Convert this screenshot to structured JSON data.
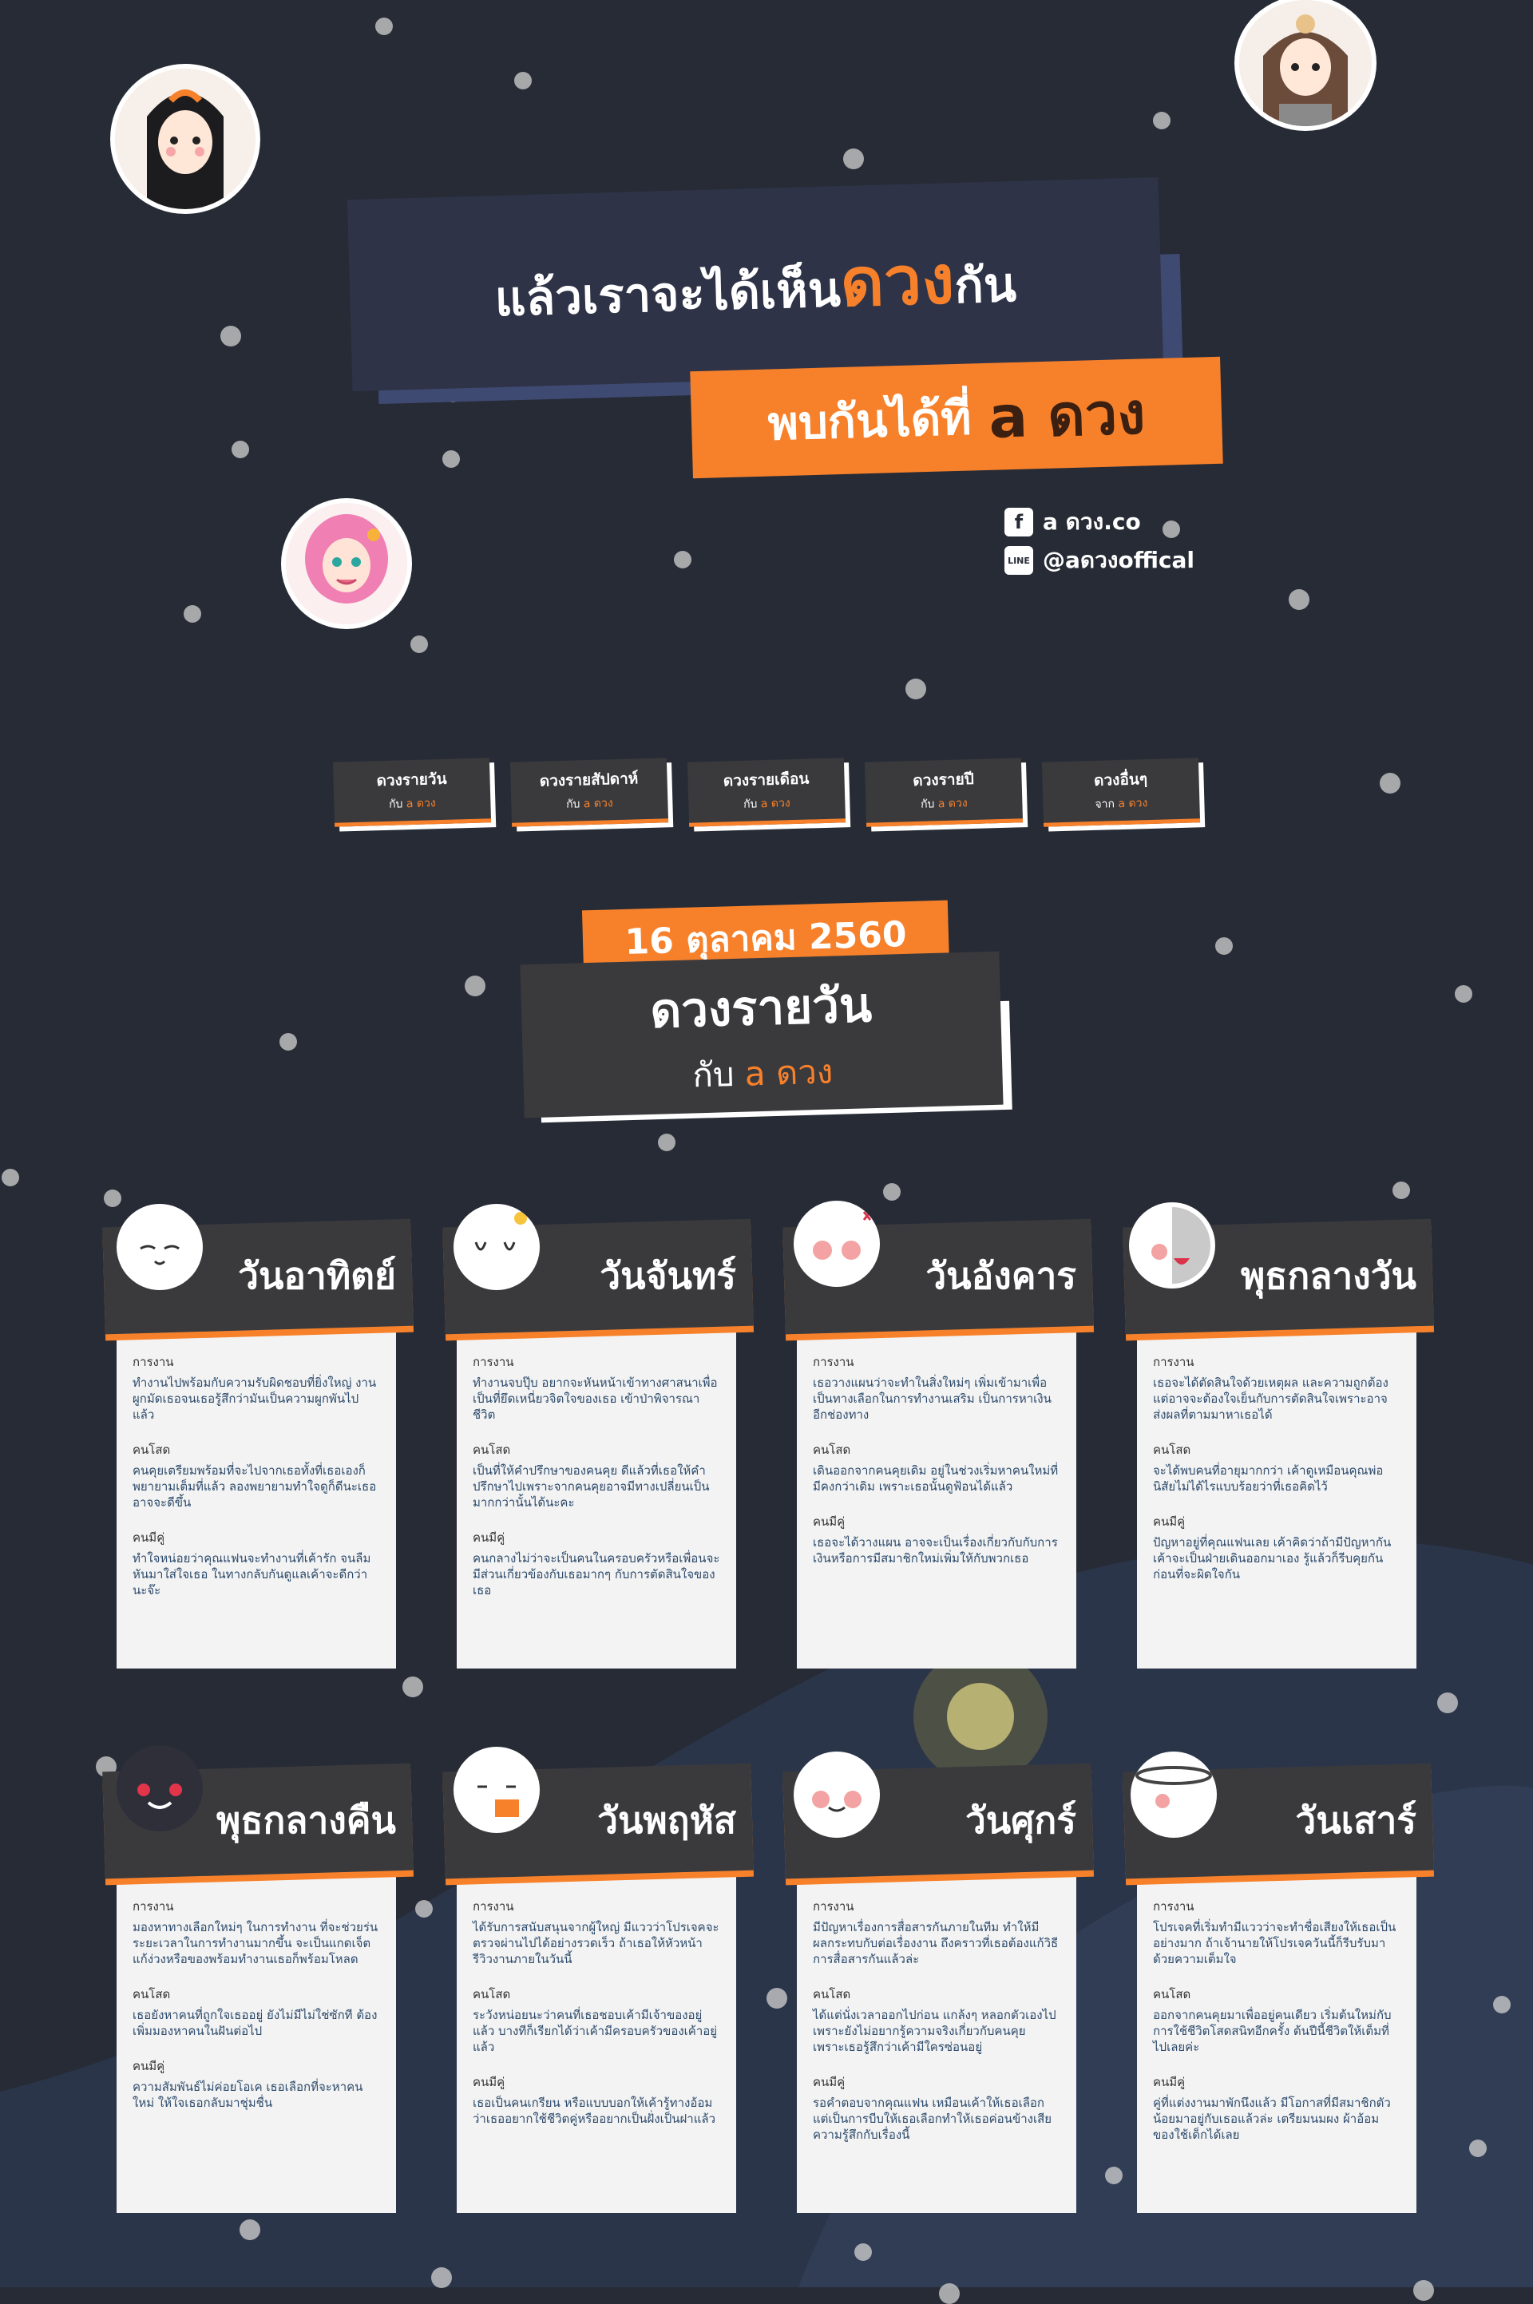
{
  "header": {
    "title_prefix": "แล้วเราจะได้เห็น",
    "title_highlight": "ดวง",
    "title_suffix": "กัน",
    "meet_text": "พบกันได้ที่",
    "meet_brand": "a ดวง"
  },
  "social": {
    "facebook": "a ดวง.co",
    "line": "@aดวงoffical",
    "facebook_icon": "facebook-icon",
    "line_icon": "line-icon"
  },
  "nav": [
    {
      "title": "ดวงรายวัน",
      "sub_prefix": "กับ",
      "sub_brand": "a ดวง"
    },
    {
      "title": "ดวงรายสัปดาห์",
      "sub_prefix": "กับ",
      "sub_brand": "a ดวง"
    },
    {
      "title": "ดวงรายเดือน",
      "sub_prefix": "กับ",
      "sub_brand": "a ดวง"
    },
    {
      "title": "ดวงรายปี",
      "sub_prefix": "กับ",
      "sub_brand": "a ดวง"
    },
    {
      "title": "ดวงอื่นๆ",
      "sub_prefix": "จาก",
      "sub_brand": "a ดวง"
    }
  ],
  "date": "16 ตุลาคม 2560",
  "section": {
    "title": "ดวงรายวัน",
    "sub_prefix": "กับ",
    "sub_brand": "a ดวง"
  },
  "colors": {
    "accent": "#f7812b",
    "bg": "#262b36",
    "panel": "#3a3a3d"
  },
  "cards": [
    {
      "day": "วันอาทิตย์",
      "work_h": "การงาน",
      "work": "ทำงานไปพร้อมกับความรับผิดชอบที่ยิ่งใหญ่ งานผูกมัดเธอจนเธอรู้สึกว่ามันเป็นความผูกพันไปแล้ว",
      "single_h": "คนโสด",
      "single": "คนคุยเตรียมพร้อมที่จะไปจากเธอทั้งที่เธอเองก็พยายามเต็มที่แล้ว ลองพยายามทำใจดูก็ดีนะเธออาจจะดีขึ้น",
      "couple_h": "คนมีคู่",
      "couple": "ทำใจหน่อยว่าคุณแฟนจะทำงานที่เค้ารัก จนลืมหันมาใส่ใจเธอ ในทางกลับกันดูแลเค้าจะดีกว่านะจ๊ะ"
    },
    {
      "day": "วันจันทร์",
      "work_h": "การงาน",
      "work": "ทำงานจบปุ๊บ อยากจะหันหน้าเข้าทางศาสนาเพื่อเป็นที่ยึดเหนี่ยวจิตใจของเธอ เข้าป่าพิจารณาชีวิต",
      "single_h": "คนโสด",
      "single": "เป็นที่ให้คำปรึกษาของคนคุย ดีแล้วที่เธอให้คำปรึกษาไปเพราะจากคนคุยอาจมีทางเปลี่ยนเป็นมากกว่านั้นได้นะคะ",
      "couple_h": "คนมีคู่",
      "couple": "คนกลางไม่ว่าจะเป็นคนในครอบครัวหรือเพื่อนจะมีส่วนเกี่ยวข้องกับเธอมากๆ กับการตัดสินใจของเธอ"
    },
    {
      "day": "วันอังคาร",
      "work_h": "การงาน",
      "work": "เธอวางแผนว่าจะทำในสิ่งใหม่ๆ เพิ่มเข้ามาเพื่อเป็นทางเลือกในการทำงานเสริม เป็นการหาเงินอีกช่องทาง",
      "single_h": "คนโสด",
      "single": "เดินออกจากคนคุยเดิม อยู่ในช่วงเริ่มหาคนใหม่ที่มีคงกว่าเดิม เพราะเธอนั้นดูฟ้อนได้แล้ว",
      "couple_h": "คนมีคู่",
      "couple": "เธอจะได้วางแผน อาจจะเป็นเรื่องเกี่ยวกับกับการเงินหรือการมีสมาชิกใหม่เพิ่มให้กับพวกเธอ"
    },
    {
      "day": "พุธกลางวัน",
      "work_h": "การงาน",
      "work": "เธอจะได้ตัดสินใจด้วยเหตุผล และความถูกต้อง แต่อาจจะต้องใจเย็นกับการตัดสินใจเพราะอาจส่งผลที่ตามมาหาเธอได้",
      "single_h": "คนโสด",
      "single": "จะได้พบคนที่อายุมากกว่า เค้าดูเหมือนคุณพ่อ นิสัยไม่ได้ไรแบบร้อยว่าที่เธอคิดไว้",
      "couple_h": "คนมีคู่",
      "couple": "ปัญหาอยู่ที่คุณแฟนเลย เค้าคิดว่าถ้ามีปัญหากันเค้าจะเป็นฝ่ายเดินออกมาเอง รู้แล้วก็รีบคุยกันก่อนที่จะผิดใจกัน"
    },
    {
      "day": "พุธกลางคืน",
      "work_h": "การงาน",
      "work": "มองหาทางเลือกใหม่ๆ ในการทำงาน ที่จะช่วยร่นระยะเวลาในการทำงานมากขึ้น จะเป็นแกดเจ็ตแก้ง่วงหรือของพร้อมทำงานเธอก็พร้อมโหลด",
      "single_h": "คนโสด",
      "single": "เธอยังหาคนที่ถูกใจเธออยู่ ยังไม่มีไม่ใช่ซักที ต้องเพิ่มมองหาคนในฝันต่อไป",
      "couple_h": "คนมีคู่",
      "couple": "ความสัมพันธ์ไม่ค่อยโอเค เธอเลือกที่จะหาคนใหม่ ให้ใจเธอกลับมาชุ่มชื่น"
    },
    {
      "day": "วันพฤหัส",
      "work_h": "การงาน",
      "work": "ได้รับการสนับสนุนจากผู้ใหญ่ มีแววว่าโปรเจคจะตรวจผ่านไปได้อย่างรวดเร็ว ถ้าเธอให้หัวหน้ารีวิวงานภายในวันนี้",
      "single_h": "คนโสด",
      "single": "ระวังหน่อยนะว่าคนที่เธอชอบเค้ามีเจ้าของอยู่แล้ว บางทีก็เรียกได้ว่าเค้ามีครอบครัวของเค้าอยู่แล้ว",
      "couple_h": "คนมีคู่",
      "couple": "เธอเป็นคนเกรียน หรือแบบบอกให้เค้ารู้ทางอ้อม ว่าเธออยากใช้ชีวิตคู่หรืออยากเป็นฝั่งเป็นฝาแล้ว"
    },
    {
      "day": "วันศุกร์",
      "work_h": "การงาน",
      "work": "มีปัญหาเรื่องการสื่อสารกันภายในทีม ทำให้มีผลกระทบกับต่อเรื่องงาน ถึงคราวที่เธอต้องแก้วิธีการสื่อสารกันแล้วล่ะ",
      "single_h": "คนโสด",
      "single": "ได้แต่นั่งเวลาออกไปก่อน แกล้งๆ หลอกตัวเองไปเพราะยังไม่อยากรู้ความจริงเกี่ยวกับคนคุย เพราะเธอรู้สึกว่าเค้ามีใครซ่อนอยู่",
      "couple_h": "คนมีคู่",
      "couple": "รอคำตอบจากคุณแฟน เหมือนเค้าให้เธอเลือก แต่เป็นการบีบให้เธอเลือกทำให้เธอค่อนข้างเสียความรู้สึกกับเรื่องนี้"
    },
    {
      "day": "วันเสาร์",
      "work_h": "การงาน",
      "work": "โปรเจคที่เริ่มทำมีแววว่าจะทำชื่อเสียงให้เธอเป็นอย่างมาก ถ้าเจ้านายให้โปรเจควันนี้ก็รีบรับมาด้วยความเต็มใจ",
      "single_h": "คนโสด",
      "single": "ออกจากคนคุยมาเพื่ออยู่คนเดียว เริ่มต้นใหม่กับการใช้ชีวิตโสดสนิทอีกครั้ง ต้นปีนี้ชีวิตให้เต็มที่ไปเลยค่ะ",
      "couple_h": "คนมีคู่",
      "couple": "คู่ที่แต่งงานมาพักนึงแล้ว มีโอกาสที่มีสมาชิกตัวน้อยมาอยู่กับเธอแล้วล่ะ เตรียมนมผง ผ้าอ้อม ของใช้เด็กได้เลย"
    }
  ]
}
